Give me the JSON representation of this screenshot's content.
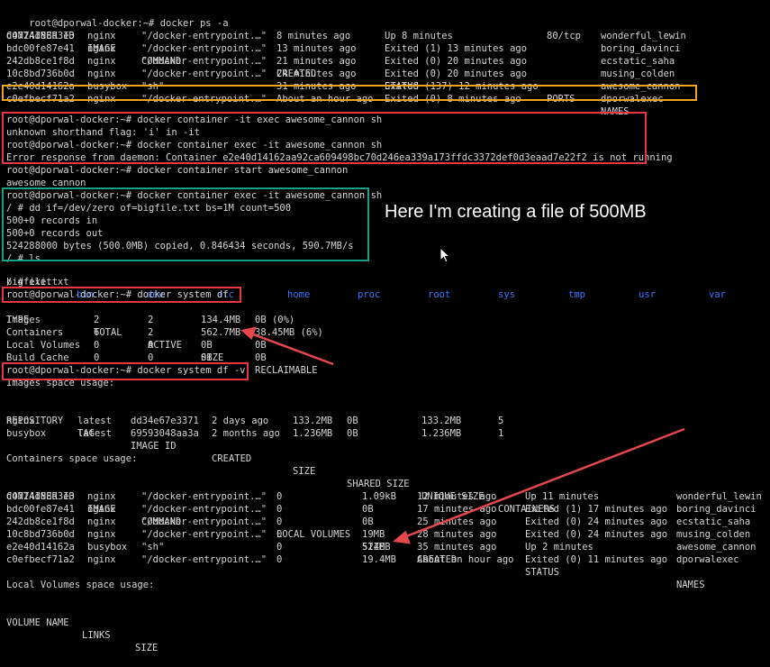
{
  "prompt": "root@dporwal-docker:~#",
  "ps": {
    "command": "docker ps -a",
    "headers": [
      "CONTAINER ID",
      "IMAGE",
      "COMMAND",
      "CREATED",
      "STATUS",
      "PORTS",
      "NAMES"
    ],
    "rows": [
      [
        "d4724d88d3e3",
        "nginx",
        "\"/docker-entrypoint.…\"",
        "8 minutes ago",
        "Up 8 minutes",
        "80/tcp",
        "wonderful_lewin"
      ],
      [
        "bdc00fe87e41",
        "nginx",
        "\"/docker-entrypoint.…\"",
        "13 minutes ago",
        "Exited (1) 13 minutes ago",
        "",
        "boring_davinci"
      ],
      [
        "242db8ce1f8d",
        "nginx",
        "\"/docker-entrypoint.…\"",
        "21 minutes ago",
        "Exited (0) 20 minutes ago",
        "",
        "ecstatic_saha"
      ],
      [
        "10c8bd736b0d",
        "nginx",
        "\"/docker-entrypoint.…\"",
        "24 minutes ago",
        "Exited (0) 20 minutes ago",
        "",
        "musing_colden"
      ],
      [
        "e2e40d14162a",
        "busybox",
        "\"sh\"",
        "31 minutes ago",
        "Exited (137) 12 minutes ago",
        "",
        "awesome_cannon"
      ],
      [
        "c0efbecf71a2",
        "nginx",
        "\"/docker-entrypoint.…\"",
        "About an hour ago",
        "Exited (0) 8 minutes ago",
        "",
        "dporwalexec"
      ]
    ]
  },
  "session": [
    "root@dporwal-docker:~# docker container -it exec awesome_cannon sh",
    "unknown shorthand flag: 'i' in -it",
    "root@dporwal-docker:~# docker container exec -it awesome_cannon sh",
    "Error response from daemon: Container e2e40d14162aa92ca609498bc70d246ea339a173ffdc3372def0d3eaad7e22f2 is not running",
    "root@dporwal-docker:~# docker container start awesome_cannon",
    "awesome_cannon",
    "root@dporwal-docker:~# docker container exec -it awesome_cannon sh",
    "/ # dd if=/dev/zero of=bigfile.txt bs=1M count=500",
    "500+0 records in",
    "500+0 records out",
    "524288000 bytes (500.0MB) copied, 0.846434 seconds, 590.7MB/s",
    "/ # ls"
  ],
  "ls_output": {
    "file": "bigfile.txt",
    "dirs": [
      "bin",
      "dev",
      "etc",
      "home",
      "proc",
      "root",
      "sys",
      "tmp",
      "usr",
      "var"
    ]
  },
  "exit_line": "/ # exit",
  "df": {
    "command_line": "root@dporwal-docker:~# docker system df",
    "headers": [
      "TYPE",
      "TOTAL",
      "ACTIVE",
      "SIZE",
      "RECLAIMABLE"
    ],
    "rows": [
      [
        "Images",
        "2",
        "2",
        "134.4MB",
        "0B (0%)"
      ],
      [
        "Containers",
        "6",
        "2",
        "562.7MB",
        "38.45MB (6%)"
      ],
      [
        "Local Volumes",
        "0",
        "0",
        "0B",
        "0B"
      ],
      [
        "Build Cache",
        "0",
        "0",
        "0B",
        "0B"
      ]
    ]
  },
  "dfv": {
    "command_line": "root@dporwal-docker:~# docker system df -v",
    "images_title": "Images space usage:",
    "images_headers": [
      "REPOSITORY",
      "TAG",
      "IMAGE ID",
      "CREATED",
      "SIZE",
      "SHARED SIZE",
      "UNIQUE SIZE",
      "CONTAINERS"
    ],
    "images_rows": [
      [
        "nginx",
        "latest",
        "dd34e67e3371",
        "2 days ago",
        "133.2MB",
        "0B",
        "133.2MB",
        "5"
      ],
      [
        "busybox",
        "latest",
        "69593048aa3a",
        "2 months ago",
        "1.236MB",
        "0B",
        "1.236MB",
        "1"
      ]
    ],
    "containers_title": "Containers space usage:",
    "containers_headers": [
      "CONTAINER ID",
      "IMAGE",
      "COMMAND",
      "LOCAL VOLUMES",
      "SIZE",
      "CREATED",
      "STATUS",
      "NAMES"
    ],
    "containers_rows": [
      [
        "d4724d88d3e3",
        "nginx",
        "\"/docker-entrypoint.…\"",
        "0",
        "1.09kB",
        "12 minutes ago",
        "Up 11 minutes",
        "wonderful_lewin"
      ],
      [
        "bdc00fe87e41",
        "nginx",
        "\"/docker-entrypoint.…\"",
        "0",
        "0B",
        "17 minutes ago",
        "Exited (1) 17 minutes ago",
        "boring_davinci"
      ],
      [
        "242db8ce1f8d",
        "nginx",
        "\"/docker-entrypoint.…\"",
        "0",
        "0B",
        "25 minutes ago",
        "Exited (0) 24 minutes ago",
        "ecstatic_saha"
      ],
      [
        "10c8bd736b0d",
        "nginx",
        "\"/docker-entrypoint.…\"",
        "0",
        "19MB",
        "28 minutes ago",
        "Exited (0) 24 minutes ago",
        "musing_colden"
      ],
      [
        "e2e40d14162a",
        "busybox",
        "\"sh\"",
        "0",
        "524MB",
        "35 minutes ago",
        "Up 2 minutes",
        "awesome_cannon"
      ],
      [
        "c0efbecf71a2",
        "nginx",
        "\"/docker-entrypoint.…\"",
        "0",
        "19.4MB",
        "About an hour ago",
        "Exited (0) 11 minutes ago",
        "dporwalexec"
      ]
    ],
    "volumes_title": "Local Volumes space usage:",
    "volumes_headers": [
      "VOLUME NAME",
      "LINKS",
      "SIZE"
    ]
  },
  "annotation_text": "Here I'm creating a file of 500MB",
  "colors": {
    "background": "#000000",
    "text": "#d4d4d4",
    "directory": "#3b78ff",
    "box_orange": "#f0a21a",
    "box_red": "#e8373e",
    "box_teal": "#16a085",
    "arrow_red": "#e5484d"
  }
}
